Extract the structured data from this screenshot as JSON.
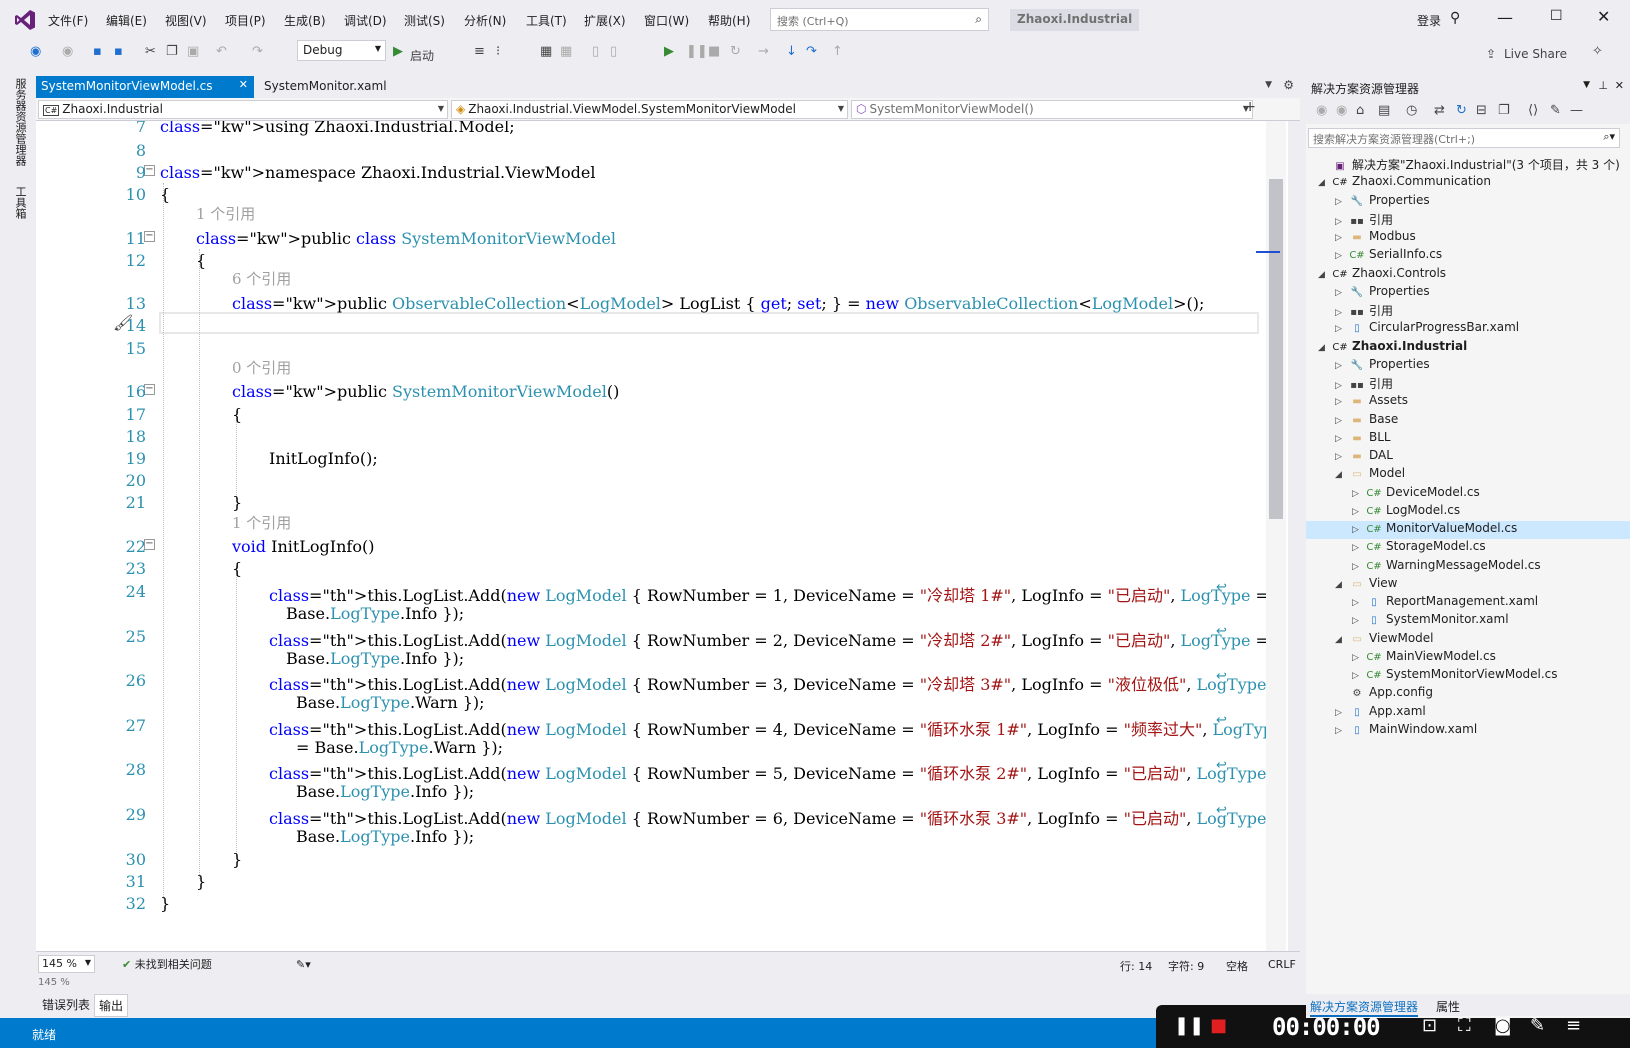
{
  "menubar": {
    "items": [
      "文件(F)",
      "编辑(E)",
      "视图(V)",
      "项目(P)",
      "生成(B)",
      "调试(D)",
      "测试(S)",
      "分析(N)",
      "工具(T)",
      "扩展(X)",
      "窗口(W)",
      "帮助(H)"
    ],
    "search_placeholder": "搜索 (Ctrl+Q)",
    "solution_title": "Zhaoxi.Industrial",
    "login": "登录"
  },
  "toolbar": {
    "config": "Debug",
    "start_label": "启动",
    "live_share": "Live Share"
  },
  "left_strip": [
    "服务器资源管理器",
    "工具箱"
  ],
  "tabs": {
    "active": "SystemMonitorViewModel.cs",
    "inactive": "SystemMonitor.xaml"
  },
  "navbar": {
    "project": "Zhaoxi.Industrial",
    "class": "Zhaoxi.Industrial.ViewModel.SystemMonitorViewModel",
    "member": "SystemMonitorViewModel()"
  },
  "editor": {
    "lines": [
      {
        "n": "7",
        "text": "using Zhaoxi.Industrial.Model;"
      },
      {
        "n": "8",
        "text": ""
      },
      {
        "n": "9",
        "text": "namespace Zhaoxi.Industrial.ViewModel"
      },
      {
        "n": "10",
        "text": "{"
      },
      {
        "n": "11",
        "text": "public class SystemMonitorViewModel"
      },
      {
        "n": "12",
        "text": "{"
      },
      {
        "n": "13",
        "text": "public ObservableCollection<LogModel> LogList { get; set; } = new ObservableCollection<LogModel>();"
      },
      {
        "n": "14",
        "text": ""
      },
      {
        "n": "15",
        "text": ""
      },
      {
        "n": "16",
        "text": "public SystemMonitorViewModel()"
      },
      {
        "n": "17",
        "text": "{"
      },
      {
        "n": "18",
        "text": ""
      },
      {
        "n": "19",
        "text": "InitLogInfo();"
      },
      {
        "n": "20",
        "text": ""
      },
      {
        "n": "21",
        "text": "}"
      },
      {
        "n": "22",
        "text": "void InitLogInfo()"
      },
      {
        "n": "23",
        "text": "{"
      },
      {
        "n": "24",
        "text": "this.LogList.Add(new LogModel { RowNumber = 1, DeviceName = \"冷却塔 1#\", LogInfo = \"已启动\", LogType ="
      },
      {
        "n": "24c",
        "text": "Base.LogType.Info });"
      },
      {
        "n": "25",
        "text": "this.LogList.Add(new LogModel { RowNumber = 2, DeviceName = \"冷却塔 2#\", LogInfo = \"已启动\", LogType ="
      },
      {
        "n": "25c",
        "text": "Base.LogType.Info });"
      },
      {
        "n": "26",
        "text": "this.LogList.Add(new LogModel { RowNumber = 3, DeviceName = \"冷却塔 3#\", LogInfo = \"液位极低\", LogType ="
      },
      {
        "n": "26c",
        "text": "Base.LogType.Warn });"
      },
      {
        "n": "27",
        "text": "this.LogList.Add(new LogModel { RowNumber = 4, DeviceName = \"循环水泵 1#\", LogInfo = \"频率过大\", LogType"
      },
      {
        "n": "27c",
        "text": "= Base.LogType.Warn });"
      },
      {
        "n": "28",
        "text": "this.LogList.Add(new LogModel { RowNumber = 5, DeviceName = \"循环水泵 2#\", LogInfo = \"已启动\", LogType ="
      },
      {
        "n": "28c",
        "text": "Base.LogType.Info });"
      },
      {
        "n": "29",
        "text": "this.LogList.Add(new LogModel { RowNumber = 6, DeviceName = \"循环水泵 3#\", LogInfo = \"已启动\", LogType ="
      },
      {
        "n": "29c",
        "text": "Base.LogType.Info });"
      },
      {
        "n": "30",
        "text": "}"
      },
      {
        "n": "31",
        "text": "}"
      },
      {
        "n": "32",
        "text": "}"
      }
    ],
    "codelens": {
      "class_refs": "1 个引用",
      "loglist_refs": "6 个引用",
      "ctor_refs": "0 个引用",
      "init_refs": "1 个引用"
    }
  },
  "status_row": {
    "zoom": "145 %",
    "issues": "未找到相关问题",
    "line": "行: 14",
    "col": "字符: 9",
    "indent": "空格",
    "eol": "CRLF"
  },
  "output_panel": {
    "header": "145 %",
    "tabs": [
      "错误列表",
      "输出"
    ]
  },
  "statusbar": {
    "text": "就绪"
  },
  "recorder": {
    "time": "00:00:00"
  },
  "solution_explorer": {
    "title": "解决方案资源管理器",
    "search_placeholder": "搜索解决方案资源管理器(Ctrl+;)",
    "items": [
      {
        "label": "解决方案\"Zhaoxi.Industrial\"(3 个项目，共 3 个)",
        "depth": 0,
        "icon": "solution-icon",
        "exp": ""
      },
      {
        "label": "Zhaoxi.Communication",
        "depth": 0,
        "icon": "csproj-icon",
        "exp": "◢"
      },
      {
        "label": "Properties",
        "depth": 1,
        "icon": "wrench-icon",
        "exp": "▷"
      },
      {
        "label": "引用",
        "depth": 1,
        "icon": "references-icon",
        "exp": "▷"
      },
      {
        "label": "Modbus",
        "depth": 1,
        "icon": "folder-icon",
        "exp": "▷"
      },
      {
        "label": "SerialInfo.cs",
        "depth": 1,
        "icon": "csfile-icon",
        "exp": "▷"
      },
      {
        "label": "Zhaoxi.Controls",
        "depth": 0,
        "icon": "csproj-icon",
        "exp": "◢"
      },
      {
        "label": "Properties",
        "depth": 1,
        "icon": "wrench-icon",
        "exp": "▷"
      },
      {
        "label": "引用",
        "depth": 1,
        "icon": "references-icon",
        "exp": "▷"
      },
      {
        "label": "CircularProgressBar.xaml",
        "depth": 1,
        "icon": "xaml-icon",
        "exp": "▷"
      },
      {
        "label": "Zhaoxi.Industrial",
        "depth": 0,
        "icon": "csproj-icon",
        "exp": "◢",
        "bold": true
      },
      {
        "label": "Properties",
        "depth": 1,
        "icon": "wrench-icon",
        "exp": "▷"
      },
      {
        "label": "引用",
        "depth": 1,
        "icon": "references-icon",
        "exp": "▷"
      },
      {
        "label": "Assets",
        "depth": 1,
        "icon": "folder-icon",
        "exp": "▷"
      },
      {
        "label": "Base",
        "depth": 1,
        "icon": "folder-icon",
        "exp": "▷"
      },
      {
        "label": "BLL",
        "depth": 1,
        "icon": "folder-icon",
        "exp": "▷"
      },
      {
        "label": "DAL",
        "depth": 1,
        "icon": "folder-icon",
        "exp": "▷"
      },
      {
        "label": "Model",
        "depth": 1,
        "icon": "folder-open-icon",
        "exp": "◢"
      },
      {
        "label": "DeviceModel.cs",
        "depth": 2,
        "icon": "csfile-icon",
        "exp": "▷"
      },
      {
        "label": "LogModel.cs",
        "depth": 2,
        "icon": "csfile-icon",
        "exp": "▷"
      },
      {
        "label": "MonitorValueModel.cs",
        "depth": 2,
        "icon": "csfile-icon",
        "exp": "▷",
        "selected": true
      },
      {
        "label": "StorageModel.cs",
        "depth": 2,
        "icon": "csfile-icon",
        "exp": "▷"
      },
      {
        "label": "WarningMessageModel.cs",
        "depth": 2,
        "icon": "csfile-icon",
        "exp": "▷"
      },
      {
        "label": "View",
        "depth": 1,
        "icon": "folder-open-icon",
        "exp": "◢"
      },
      {
        "label": "ReportManagement.xaml",
        "depth": 2,
        "icon": "xaml-icon",
        "exp": "▷"
      },
      {
        "label": "SystemMonitor.xaml",
        "depth": 2,
        "icon": "xaml-icon",
        "exp": "▷"
      },
      {
        "label": "ViewModel",
        "depth": 1,
        "icon": "folder-open-icon",
        "exp": "◢"
      },
      {
        "label": "MainViewModel.cs",
        "depth": 2,
        "icon": "csfile-icon",
        "exp": "▷"
      },
      {
        "label": "SystemMonitorViewModel.cs",
        "depth": 2,
        "icon": "csfile-icon",
        "exp": "▷"
      },
      {
        "label": "App.config",
        "depth": 1,
        "icon": "config-icon",
        "exp": ""
      },
      {
        "label": "App.xaml",
        "depth": 1,
        "icon": "xaml-icon",
        "exp": "▷"
      },
      {
        "label": "MainWindow.xaml",
        "depth": 1,
        "icon": "xaml-icon",
        "exp": "▷"
      }
    ],
    "bottom_tabs": [
      "解决方案资源管理器",
      "属性"
    ]
  }
}
